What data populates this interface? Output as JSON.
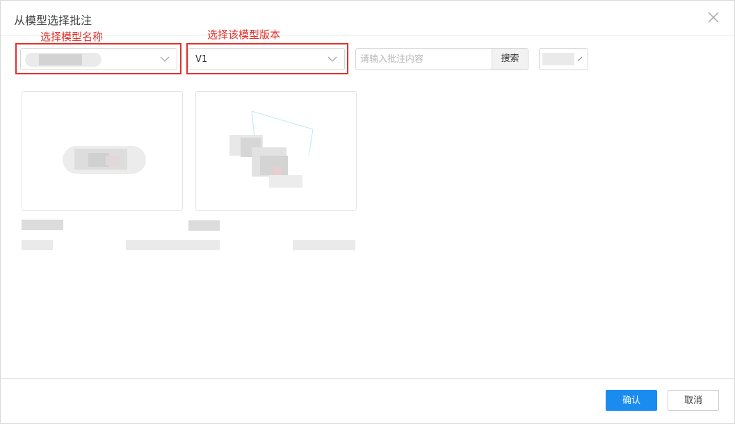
{
  "dialog": {
    "title": "从模型选择批注",
    "close_icon": "close-icon"
  },
  "annotations": {
    "model_name": "选择模型名称",
    "model_version": "选择该模型版本"
  },
  "toolbar": {
    "model_select": {
      "value": ""
    },
    "version_select": {
      "value": "V1"
    },
    "search": {
      "placeholder": "请输入批注内容",
      "value": "",
      "button_label": "搜索"
    },
    "filter_select": {
      "value": ""
    }
  },
  "cards": [
    {
      "title": "",
      "meta": ""
    },
    {
      "title": "",
      "meta": ""
    }
  ],
  "footer": {
    "confirm_label": "确认",
    "cancel_label": "取消"
  },
  "colors": {
    "accent": "#1a8cf0",
    "annotation_red": "#e0302b"
  }
}
